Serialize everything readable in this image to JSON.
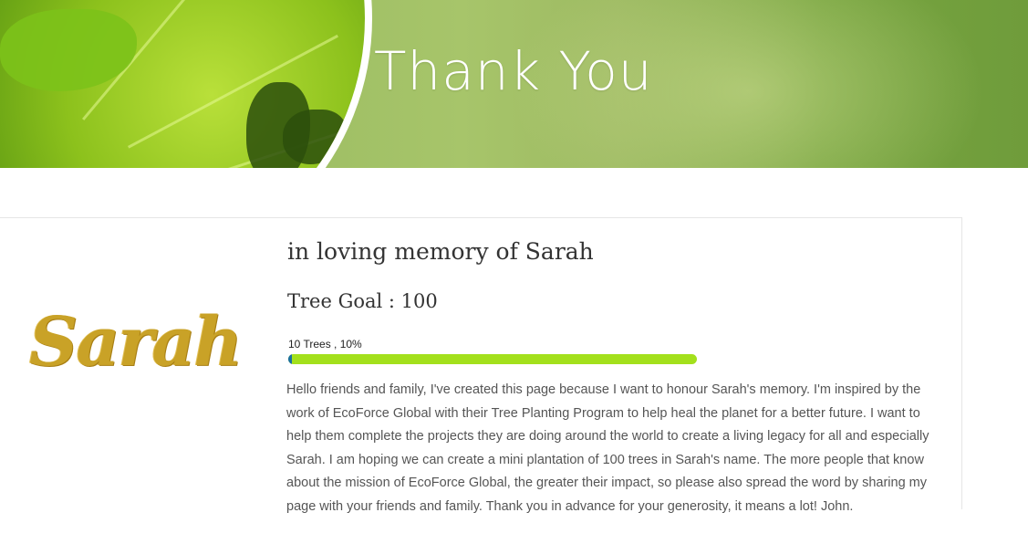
{
  "banner": {
    "title": "Thank You"
  },
  "profile": {
    "logo_text": "Sarah"
  },
  "campaign": {
    "title": "in loving memory of Sarah",
    "goal_text": "Tree Goal : 100",
    "progress_label": "10 Trees , 10%",
    "progress_fraction": 0.01,
    "description": "Hello friends and family, I've created this page because I want to honour Sarah's memory. I'm inspired by the work of EcoForce Global with their Tree Planting Program to help heal the planet for a better future. I want to help them complete the projects they are doing around the world to create a living legacy for all and especially Sarah. I am hoping we can create a mini plantation of 100 trees in Sarah's name. The more people that know about the mission of EcoForce Global, the greater their impact, so please also spread the word by sharing my page with your friends and family. Thank you in advance for your generosity, it means a lot! John."
  },
  "colors": {
    "progress_track": "#a3e01c",
    "progress_fill": "#1a6fa0",
    "logo_gold": "#c9a227",
    "banner_green": "#8fb35a"
  }
}
